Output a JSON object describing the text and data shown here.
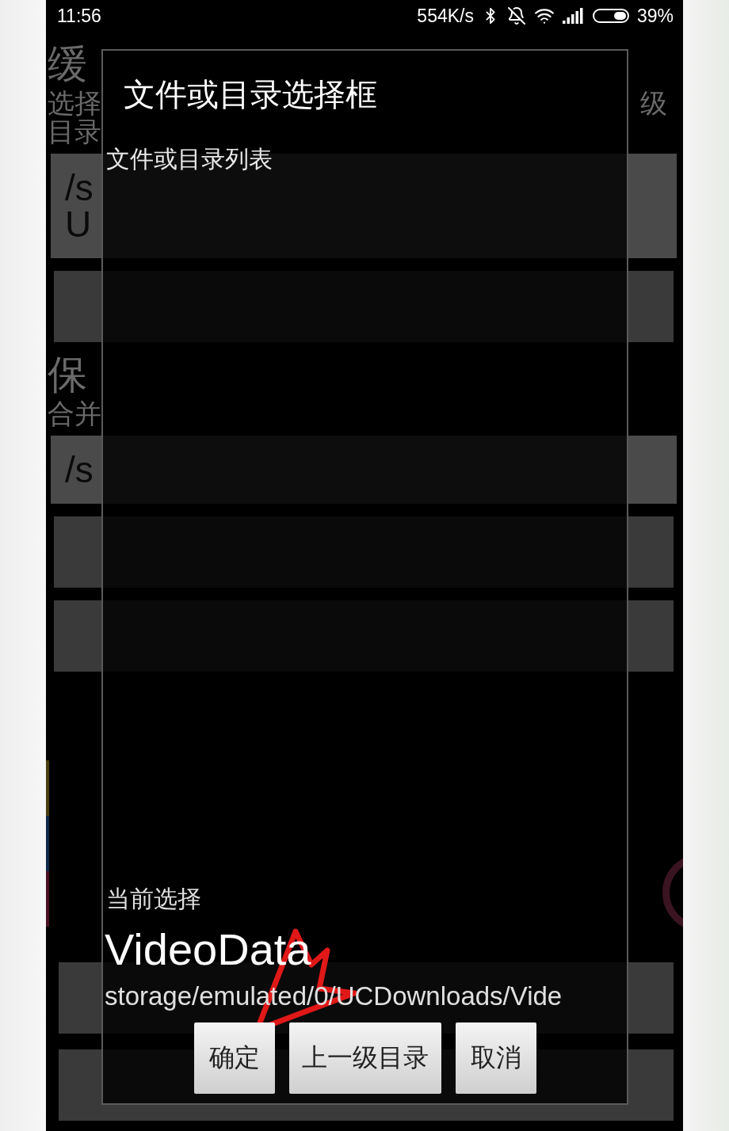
{
  "status_bar": {
    "time": "11:56",
    "speed": "554K/s",
    "battery": "39%"
  },
  "background": {
    "sections": [
      {
        "heading": "缓",
        "description_lines": [
          {
            "left": "选择",
            "right": "级"
          },
          {
            "left": "目录"
          }
        ],
        "path_lines": [
          "/s",
          "U"
        ]
      },
      {
        "heading": "保",
        "description_lines": [
          {
            "left": "合并"
          }
        ],
        "path_lines": [
          "/s"
        ]
      }
    ]
  },
  "dialog": {
    "title": "文件或目录选择框",
    "list_label": "文件或目录列表",
    "current_label": "当前选择",
    "current_name": "VideoData",
    "current_path": "storage/emulated/0/UCDownloads/Vide",
    "buttons": [
      "确定",
      "上一级目录",
      "取消"
    ]
  }
}
